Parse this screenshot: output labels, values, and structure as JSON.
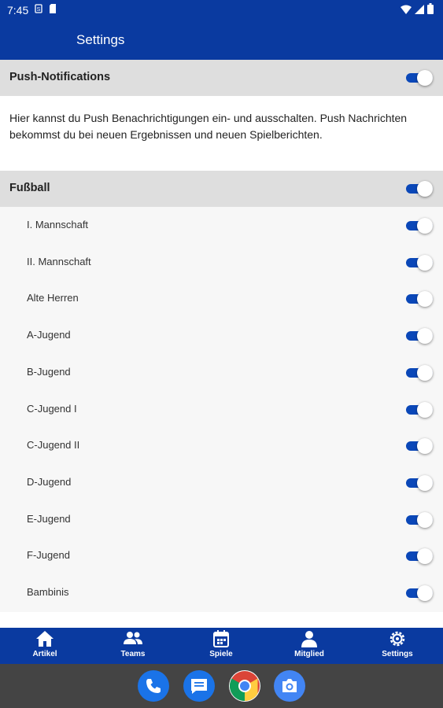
{
  "status_bar": {
    "time": "7:45"
  },
  "app_bar": {
    "title": "Settings"
  },
  "push": {
    "label": "Push-Notifications",
    "enabled": true,
    "description": "Hier kannst du Push Benachrichtigungen ein- und ausschalten. Push Nachrichten bekommst du bei neuen Ergebnissen und neuen Spielberichten."
  },
  "football": {
    "label": "Fußball",
    "enabled": true,
    "teams": [
      {
        "label": "I. Mannschaft",
        "enabled": true
      },
      {
        "label": "II. Mannschaft",
        "enabled": true
      },
      {
        "label": "Alte Herren",
        "enabled": true
      },
      {
        "label": "A-Jugend",
        "enabled": true
      },
      {
        "label": "B-Jugend",
        "enabled": true
      },
      {
        "label": "C-Jugend I",
        "enabled": true
      },
      {
        "label": "C-Jugend II",
        "enabled": true
      },
      {
        "label": "D-Jugend",
        "enabled": true
      },
      {
        "label": "E-Jugend",
        "enabled": true
      },
      {
        "label": "F-Jugend",
        "enabled": true
      },
      {
        "label": "Bambinis",
        "enabled": true
      }
    ]
  },
  "bottom_nav": {
    "items": [
      {
        "label": "Artikel",
        "icon": "home-icon"
      },
      {
        "label": "Teams",
        "icon": "people-icon"
      },
      {
        "label": "Spiele",
        "icon": "calendar-icon"
      },
      {
        "label": "Mitglied",
        "icon": "person-icon"
      },
      {
        "label": "Settings",
        "icon": "gear-icon"
      }
    ]
  },
  "dock": {
    "apps": [
      "phone-icon",
      "messages-icon",
      "chrome-icon",
      "camera-icon"
    ]
  },
  "colors": {
    "primary": "#0a3aa0",
    "toggle_on": "#0a47b8",
    "section_bg": "#dedede",
    "list_bg": "#f7f7f7"
  }
}
